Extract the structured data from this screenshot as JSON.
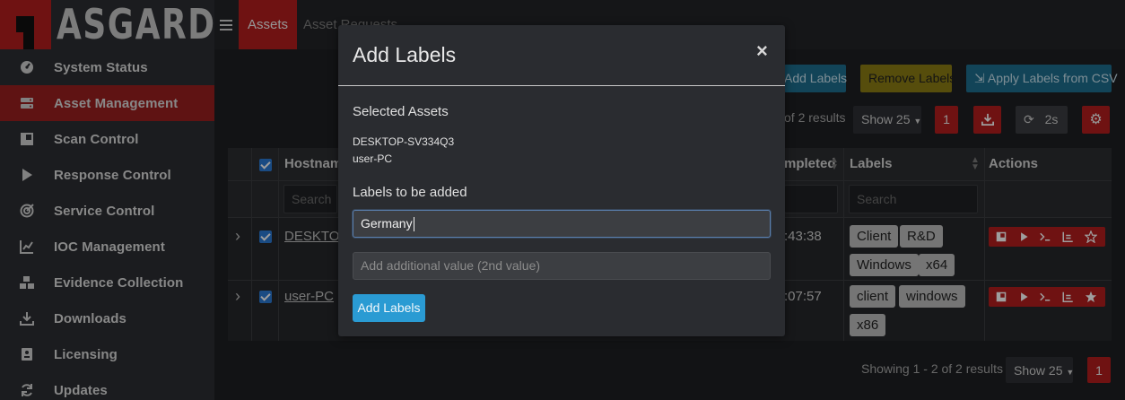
{
  "app": {
    "brand": "ASGARD",
    "brand_color": "#b31d1d"
  },
  "topbar": {
    "tabs": [
      {
        "label": "Assets",
        "active": true
      },
      {
        "label": "Asset Requests",
        "active": false
      }
    ]
  },
  "sidebar": {
    "items": [
      {
        "label": "System Status",
        "icon": "dashboard-gauge-icon",
        "active": false
      },
      {
        "label": "Asset Management",
        "icon": "server-icon",
        "active": true
      },
      {
        "label": "Scan Control",
        "icon": "scan-square-icon",
        "active": false
      },
      {
        "label": "Response Control",
        "icon": "play-icon",
        "active": false
      },
      {
        "label": "Service Control",
        "icon": "target-icon",
        "active": false
      },
      {
        "label": "IOC Management",
        "icon": "chart-line-icon",
        "active": false
      },
      {
        "label": "Evidence Collection",
        "icon": "boxes-icon",
        "active": false
      },
      {
        "label": "Downloads",
        "icon": "download-icon",
        "active": false
      },
      {
        "label": "Licensing",
        "icon": "id-card-icon",
        "active": false
      },
      {
        "label": "Updates",
        "icon": "sync-icon",
        "active": false
      }
    ]
  },
  "toolbar": {
    "add_labels": "Add Labels",
    "remove_labels": "Remove Labels",
    "apply_csv": "Apply Labels from CSV",
    "results_top": "of 2 results",
    "page_size": "Show 25",
    "page": "1",
    "refresh_interval": "2s"
  },
  "table": {
    "headers": {
      "hostname": "Hostname",
      "completed": "mpleted",
      "labels": "Labels",
      "actions": "Actions"
    },
    "filter_placeholder": "Search",
    "rows": [
      {
        "hostname": "DESKTOP",
        "completed": ":43:38",
        "labels": [
          "Client",
          "R&D",
          "Windows",
          "x64"
        ]
      },
      {
        "hostname": "user-PC",
        "completed": ":07:57",
        "labels": [
          "client",
          "windows",
          "x86"
        ]
      }
    ]
  },
  "footer": {
    "results": "Showing 1 - 2 of 2 results",
    "page_size": "Show 25",
    "page": "1"
  },
  "modal": {
    "title": "Add Labels",
    "close": "×",
    "selected_assets_title": "Selected Assets",
    "selected_assets": [
      "DESKTOP-SV334Q3",
      "user-PC"
    ],
    "labels_title": "Labels to be added",
    "label_value": "Germany",
    "second_value_placeholder": "Add additional value (2nd value)",
    "submit": "Add Labels"
  },
  "colors": {
    "primary": "#2a9bd3",
    "danger": "#b31d1d",
    "warning": "#8c7d14",
    "info": "#1e6f8e",
    "checkbox": "#2b79d4"
  }
}
